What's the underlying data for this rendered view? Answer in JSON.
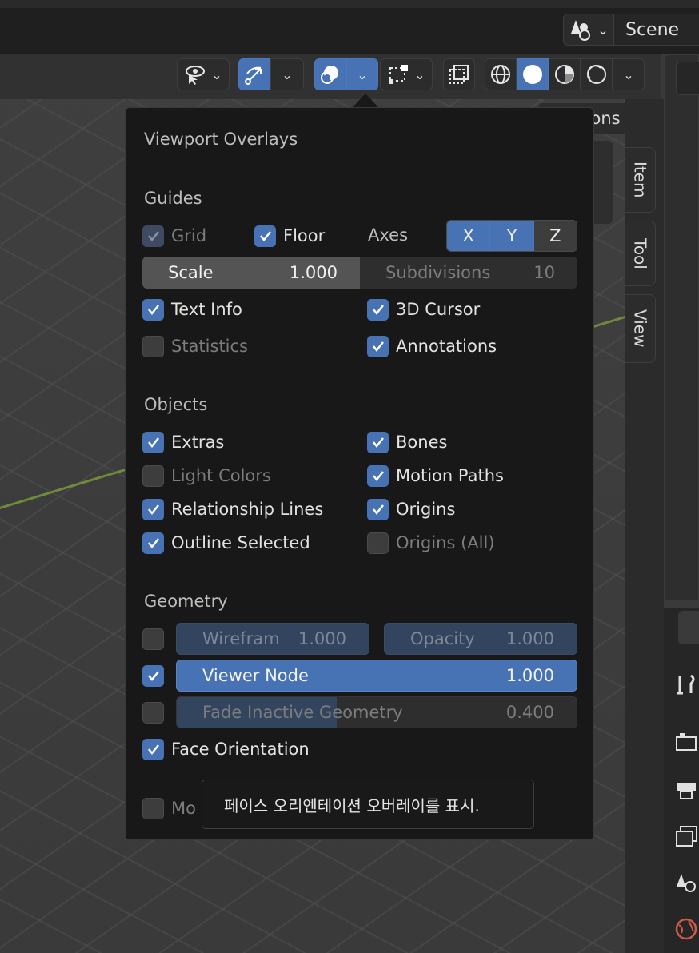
{
  "topbar": {
    "scene_label": "Scene"
  },
  "viewport_header": {
    "options_partial": "ons"
  },
  "side_tabs": [
    "Item",
    "Tool",
    "View"
  ],
  "popup": {
    "title": "Viewport Overlays",
    "guides": {
      "heading": "Guides",
      "grid": "Grid",
      "floor": "Floor",
      "axes": "Axes",
      "axis_buttons": [
        "X",
        "Y",
        "Z"
      ],
      "scale_label": "Scale",
      "scale_value": "1.000",
      "subdivisions_label": "Subdivisions",
      "subdivisions_value": "10",
      "text_info": "Text Info",
      "cursor_3d": "3D Cursor",
      "statistics": "Statistics",
      "annotations": "Annotations"
    },
    "objects": {
      "heading": "Objects",
      "extras": "Extras",
      "bones": "Bones",
      "light_colors": "Light Colors",
      "motion_paths": "Motion Paths",
      "relationship_lines": "Relationship Lines",
      "origins": "Origins",
      "outline_selected": "Outline Selected",
      "origins_all": "Origins (All)"
    },
    "geometry": {
      "heading": "Geometry",
      "wireframe_label": "Wirefram",
      "wireframe_value": "1.000",
      "opacity_label": "Opacity",
      "opacity_value": "1.000",
      "viewer_node_label": "Viewer Node",
      "viewer_node_value": "1.000",
      "fade_label": "Fade Inactive Geometry",
      "fade_value": "0.400",
      "fade_fraction": 0.4,
      "face_orientation": "Face Orientation",
      "motion_partial": "Mo"
    }
  },
  "tooltip": {
    "text": "페이스 오리엔테이션 오버레이를 표시."
  },
  "colors": {
    "accent": "#4772b3",
    "popup_bg": "#181818",
    "viewport_bg": "#3a3a3a"
  }
}
